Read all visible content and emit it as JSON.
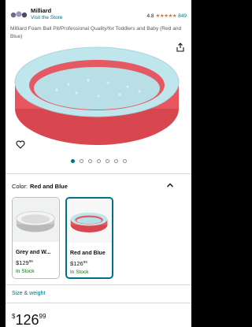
{
  "store": {
    "brand": "Milliard",
    "visit_label": "Visit the Store"
  },
  "rating": {
    "value": "4.8",
    "stars": "★★★★★",
    "count": "849"
  },
  "product": {
    "title": "Milliard Foam Ball Pit/Professional Quality/for Toddlers and Baby (Red and Blue)",
    "image_count": 7,
    "active_image": 0
  },
  "color": {
    "label": "Color:",
    "selected": "Red and Blue",
    "options": [
      {
        "name": "Grey and W...",
        "price_whole": "$129",
        "price_frac": "99",
        "stock": "In Stock"
      },
      {
        "name": "Red and Blue",
        "price_whole": "$126",
        "price_frac": "99",
        "stock": "In Stock"
      }
    ]
  },
  "size_weight_label": "Size & weight",
  "price": {
    "currency": "$",
    "whole": "126",
    "fraction": "99"
  },
  "colors": {
    "link": "#007185",
    "stock": "#007600",
    "star": "#de7921",
    "pit_red": "#e8575f",
    "pit_blue": "#bfe6ec"
  }
}
